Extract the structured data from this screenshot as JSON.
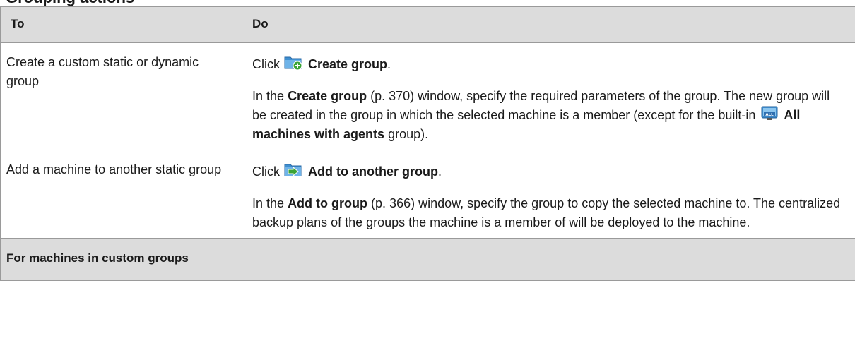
{
  "page": {
    "heading": "Grouping actions"
  },
  "table": {
    "headers": {
      "to": "To",
      "do": "Do"
    },
    "rows": [
      {
        "to": "Create a custom static or dynamic group",
        "click_prefix": "Click",
        "action_icon": "create-group-folder-icon",
        "action_label": "Create group",
        "after_label": ".",
        "p_in": "In the",
        "p_bold1": "Create group",
        "p_ref1": "(p. 370) window, specify the required parameters of the group. The new group will be created in the group in which the selected machine is a member (except for the built-in",
        "inline_icon": "all-machines-icon",
        "p_bold2": "All machines with agents",
        "p_end": "group)."
      },
      {
        "to": "Add a machine to another static group",
        "click_prefix": "Click",
        "action_icon": "add-to-group-folder-icon",
        "action_label": "Add to another group",
        "after_label": ".",
        "p_in": "In the",
        "p_bold1": "Add to group",
        "p_ref1": "(p. 366) window, specify the group to copy the selected machine to. The centralized backup plans of the groups the machine is a member of will be deployed to the machine."
      }
    ],
    "section": {
      "label": "For machines in custom groups"
    }
  },
  "colors": {
    "header_bg": "#dcdcdc",
    "border": "#9a9a9a",
    "folder_blue": "#3f8fd0",
    "badge_green": "#3aa335"
  }
}
